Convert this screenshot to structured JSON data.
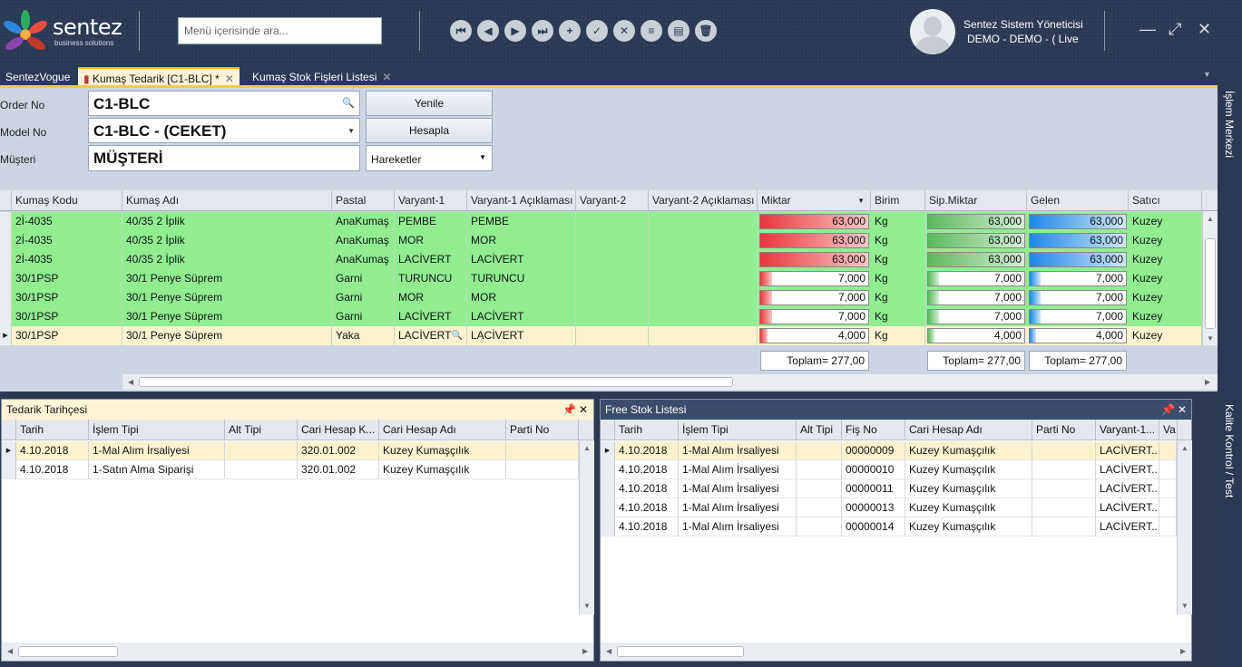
{
  "header": {
    "brand": "sentez",
    "tagline": "business solutions",
    "search_placeholder": "Menü içerisinde ara...",
    "toolbar_icons": [
      "first-icon",
      "prev-icon",
      "next-icon",
      "last-icon",
      "add-icon",
      "approve-icon",
      "cancel-icon",
      "list-icon",
      "card-icon",
      "delete-icon"
    ],
    "user_name": "Sentez Sistem Yöneticisi",
    "user_context": "DEMO - DEMO - ( Live"
  },
  "tabs": [
    {
      "label": "SentezVogue"
    },
    {
      "label": "Kumaş Tedarik [C1-BLC]  *"
    },
    {
      "label": "Kumaş Stok Fişleri Listesi"
    }
  ],
  "side": {
    "top": "İşlem Merkezi",
    "bottom": "Kalite Kontrol / Test"
  },
  "form": {
    "order_label": "Order No",
    "order_value": "C1-BLC",
    "model_label": "Model No",
    "model_value": "C1-BLC - (CEKET)",
    "customer_label": "Müşteri",
    "customer_value": "MÜŞTERİ",
    "refresh": "Yenile",
    "calc": "Hesapla",
    "actions": "Hareketler"
  },
  "grid": {
    "columns": [
      "Kumaş Kodu",
      "Kumaş Adı",
      "Pastal",
      "Varyant-1",
      "Varyant-1 Açıklaması",
      "Varyant-2",
      "Varyant-2 Açıklaması",
      "Miktar",
      "Birim",
      "Sip.Miktar",
      "Gelen",
      "Satıcı"
    ],
    "rows": [
      {
        "code": "2İ-4035",
        "name": "40/35 2 İplik",
        "pastal": "AnaKumaş",
        "v1": "PEMBE",
        "v1d": "PEMBE",
        "qty": "63,000",
        "qty_n": 63,
        "unit": "Kg",
        "sip": "63,000",
        "gelen": "63,000",
        "vendor": "Kuzey"
      },
      {
        "code": "2İ-4035",
        "name": "40/35 2 İplik",
        "pastal": "AnaKumaş",
        "v1": "MOR",
        "v1d": "MOR",
        "qty": "63,000",
        "qty_n": 63,
        "unit": "Kg",
        "sip": "63,000",
        "gelen": "63,000",
        "vendor": "Kuzey"
      },
      {
        "code": "2İ-4035",
        "name": "40/35 2 İplik",
        "pastal": "AnaKumaş",
        "v1": "LACİVERT",
        "v1d": "LACİVERT",
        "qty": "63,000",
        "qty_n": 63,
        "unit": "Kg",
        "sip": "63,000",
        "gelen": "63,000",
        "vendor": "Kuzey"
      },
      {
        "code": "30/1PSP",
        "name": "30/1 Penye Süprem",
        "pastal": "Garni",
        "v1": "TURUNCU",
        "v1d": "TURUNCU",
        "qty": "7,000",
        "qty_n": 7,
        "unit": "Kg",
        "sip": "7,000",
        "gelen": "7,000",
        "vendor": "Kuzey"
      },
      {
        "code": "30/1PSP",
        "name": "30/1 Penye Süprem",
        "pastal": "Garni",
        "v1": "MOR",
        "v1d": "MOR",
        "qty": "7,000",
        "qty_n": 7,
        "unit": "Kg",
        "sip": "7,000",
        "gelen": "7,000",
        "vendor": "Kuzey"
      },
      {
        "code": "30/1PSP",
        "name": "30/1 Penye Süprem",
        "pastal": "Garni",
        "v1": "LACİVERT",
        "v1d": "LACİVERT",
        "qty": "7,000",
        "qty_n": 7,
        "unit": "Kg",
        "sip": "7,000",
        "gelen": "7,000",
        "vendor": "Kuzey"
      },
      {
        "code": "30/1PSP",
        "name": "30/1 Penye Süprem",
        "pastal": "Yaka",
        "v1": "LACİVERT",
        "v1d": "LACİVERT",
        "qty": "4,000",
        "qty_n": 4,
        "unit": "Kg",
        "sip": "4,000",
        "gelen": "4,000",
        "vendor": "Kuzey"
      }
    ],
    "totals": {
      "qty": "Toplam= 277,00",
      "sip": "Toplam= 277,00",
      "gelen": "Toplam= 277,00"
    },
    "bar_max": 63
  },
  "history": {
    "title": "Tedarik Tarihçesi",
    "columns": [
      "Tarih",
      "İşlem Tipi",
      "Alt Tipi",
      "Cari Hesap K...",
      "Cari Hesap Adı",
      "Parti No"
    ],
    "rows": [
      [
        "4.10.2018",
        "1-Mal Alım İrsaliyesi",
        "",
        "320.01.002",
        "Kuzey Kumaşçılık",
        ""
      ],
      [
        "4.10.2018",
        "1-Satın Alma Siparişi",
        "",
        "320.01.002",
        "Kuzey Kumaşçılık",
        ""
      ]
    ]
  },
  "freestock": {
    "title": "Free Stok Listesi",
    "columns": [
      "Tarih",
      "İşlem Tipi",
      "Alt Tipi",
      "Fiş No",
      "Cari Hesap Adı",
      "Parti No",
      "Varyant-1...",
      "Va"
    ],
    "rows": [
      [
        "4.10.2018",
        "1-Mal Alım İrsaliyesi",
        "",
        "00000009",
        "Kuzey Kumaşçılık",
        "",
        "LACİVERT...",
        ""
      ],
      [
        "4.10.2018",
        "1-Mal Alım İrsaliyesi",
        "",
        "00000010",
        "Kuzey Kumaşçılık",
        "",
        "LACİVERT...",
        ""
      ],
      [
        "4.10.2018",
        "1-Mal Alım İrsaliyesi",
        "",
        "00000011",
        "Kuzey Kumaşçılık",
        "",
        "LACİVERT...",
        ""
      ],
      [
        "4.10.2018",
        "1-Mal Alım İrsaliyesi",
        "",
        "00000013",
        "Kuzey Kumaşçılık",
        "",
        "LACİVERT...",
        ""
      ],
      [
        "4.10.2018",
        "1-Mal Alım İrsaliyesi",
        "",
        "00000014",
        "Kuzey Kumaşçılık",
        "",
        "LACİVERT...",
        ""
      ]
    ]
  }
}
